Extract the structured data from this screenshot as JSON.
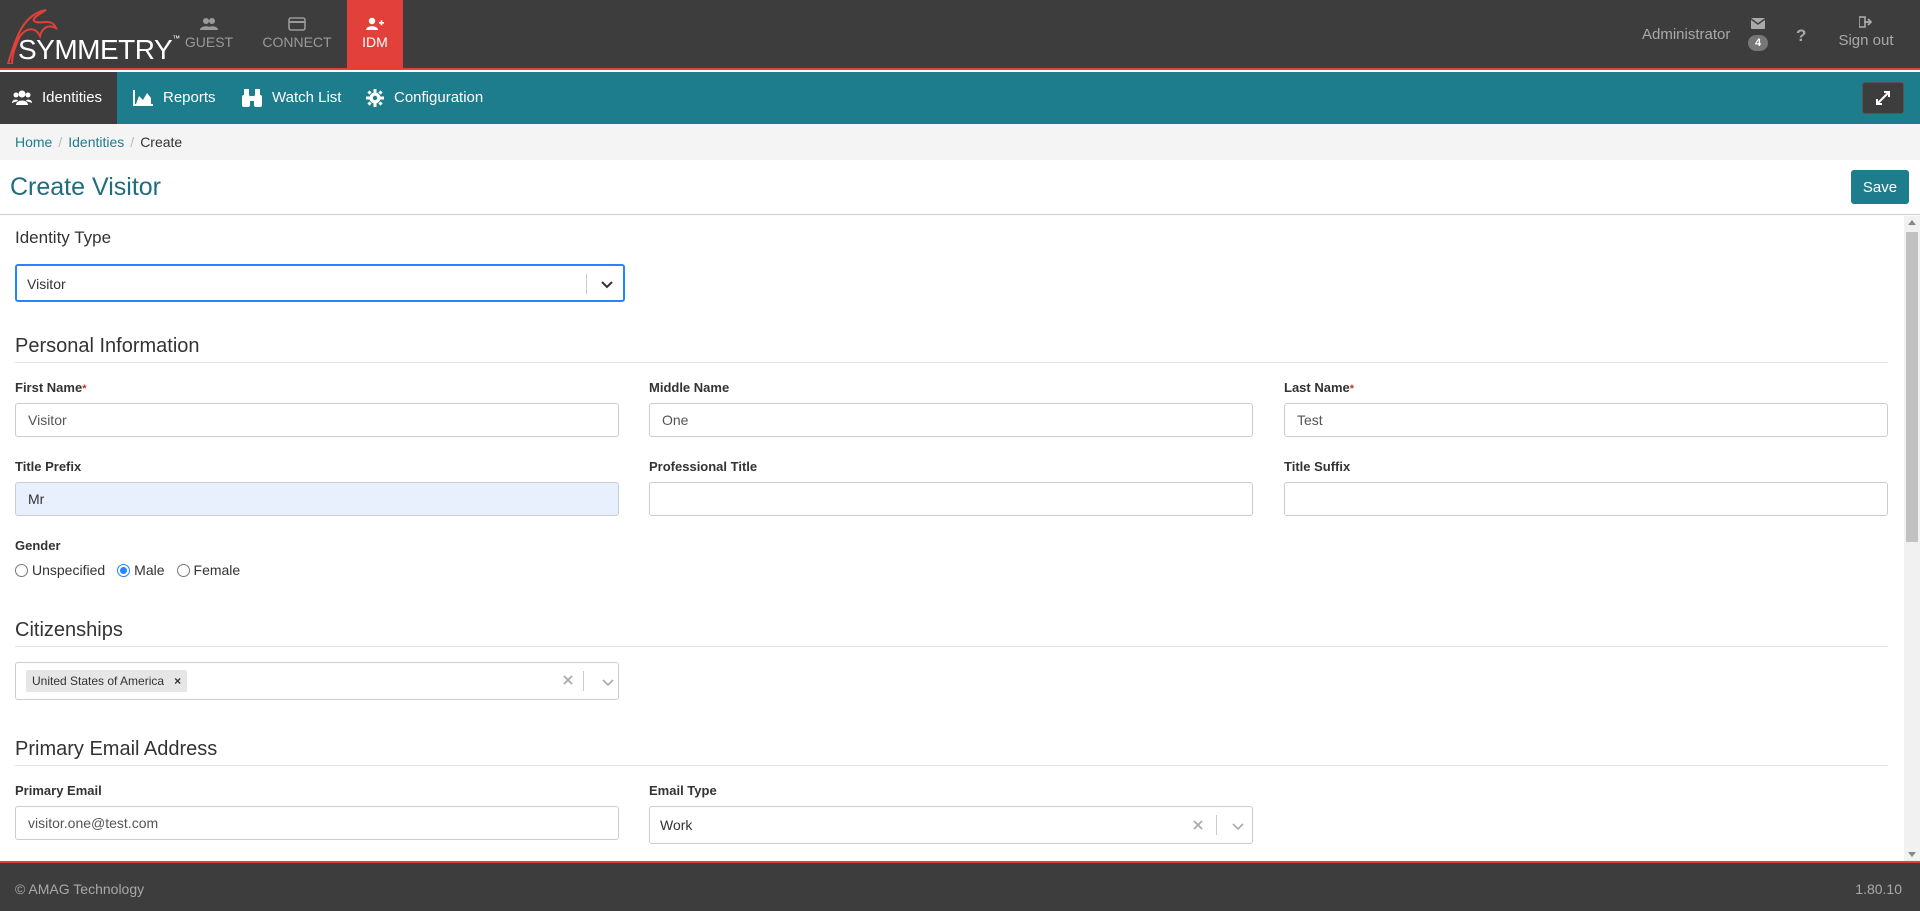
{
  "brand": {
    "logo_text": "SYMMETRY",
    "trademark": "™"
  },
  "apps": [
    {
      "label": "GUEST",
      "icon": "users-icon"
    },
    {
      "label": "CONNECT",
      "icon": "card-icon"
    },
    {
      "label": "IDM",
      "icon": "user-plus-icon",
      "active": true
    }
  ],
  "header": {
    "user": "Administrator",
    "mail_count": "4",
    "help": "?",
    "signout": "Sign out"
  },
  "nav": [
    {
      "label": "Identities",
      "icon": "users-icon",
      "active": true
    },
    {
      "label": "Reports",
      "icon": "area-chart-icon"
    },
    {
      "label": "Watch List",
      "icon": "binoculars-icon"
    },
    {
      "label": "Configuration",
      "icon": "gear-icon"
    }
  ],
  "breadcrumb": {
    "home": "Home",
    "identities": "Identities",
    "current": "Create"
  },
  "page": {
    "title": "Create Visitor",
    "save": "Save"
  },
  "identity_type": {
    "heading": "Identity Type",
    "value": "Visitor"
  },
  "personal": {
    "heading": "Personal Information",
    "first_name_label": "First Name",
    "first_name": "Visitor",
    "middle_name_label": "Middle Name",
    "middle_name": "One",
    "last_name_label": "Last Name",
    "last_name": "Test",
    "title_prefix_label": "Title Prefix",
    "title_prefix": "Mr",
    "professional_title_label": "Professional Title",
    "professional_title": "",
    "title_suffix_label": "Title Suffix",
    "title_suffix": "",
    "gender_label": "Gender",
    "gender_options": [
      "Unspecified",
      "Male",
      "Female"
    ],
    "gender_selected": "Male",
    "required_marker": "*"
  },
  "citizenships": {
    "heading": "Citizenships",
    "tags": [
      "United States of America"
    ]
  },
  "email": {
    "heading": "Primary Email Address",
    "primary_label": "Primary Email",
    "primary_value": "visitor.one@test.com",
    "type_label": "Email Type",
    "type_value": "Work"
  },
  "footer": {
    "copyright": "© AMAG Technology",
    "version": "1.80.10"
  },
  "colors": {
    "accent": "#e2403b",
    "teal": "#1e7d8c",
    "dark": "#3d3d3d",
    "focus": "#2684ff"
  }
}
